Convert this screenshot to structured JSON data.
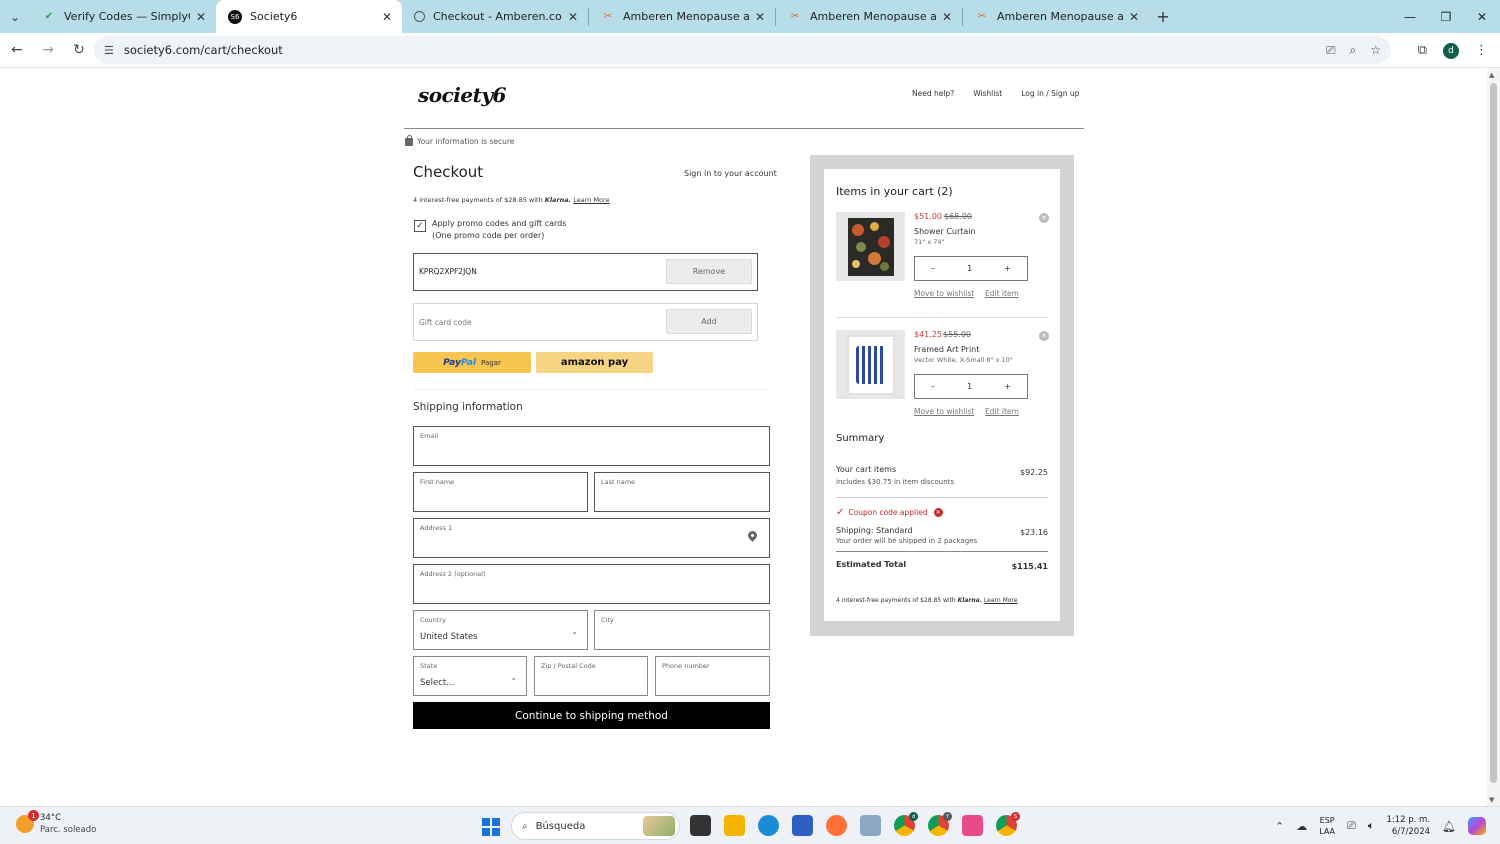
{
  "browser": {
    "tabs": [
      {
        "title": "Verify Codes — SimplyCodes",
        "active": false
      },
      {
        "title": "Society6",
        "active": true
      },
      {
        "title": "Checkout - Amberen.com",
        "active": false
      },
      {
        "title": "Amberen Menopause and Perin",
        "active": false
      },
      {
        "title": "Amberen Menopause and Perin",
        "active": false
      },
      {
        "title": "Amberen Menopause and Perin",
        "active": false
      }
    ],
    "url": "society6.com/cart/checkout",
    "profile_initial": "d"
  },
  "header": {
    "logo": "society6",
    "links": [
      "Need help?",
      "Wishlist",
      "Log in / Sign up"
    ],
    "secure_note": "Your information is secure"
  },
  "checkout": {
    "title": "Checkout",
    "sign_in": "Sign in to your account",
    "klarna": {
      "prefix": "4 interest-free payments of $28.85 with",
      "brand": "Klarna.",
      "link": "Learn More"
    },
    "promo_toggle": {
      "line1": "Apply promo codes and gift cards",
      "line2": "(One promo code per order)",
      "checked": true
    },
    "promo_code": {
      "value": "KPRQ2XPF2JQN",
      "button": "Remove"
    },
    "gift_card": {
      "placeholder": "Gift card code",
      "button": "Add"
    },
    "paypal": {
      "brand1": "Pay",
      "brand2": "Pal",
      "label": "Pagar"
    },
    "amazon_pay": "amazon pay",
    "shipping": {
      "title": "Shipping information",
      "email_label": "Email",
      "first_name_label": "First name",
      "last_name_label": "Last name",
      "address1_label": "Address 1",
      "address2_label": "Address 2 (optional)",
      "country_label": "Country",
      "country_value": "United States",
      "city_label": "City",
      "state_label": "State",
      "state_value": "Select...",
      "zip_label": "Zip / Postal Code",
      "phone_label": "Phone number"
    },
    "continue_button": "Continue to shipping method"
  },
  "cart": {
    "title": "Items in your cart (2)",
    "items": [
      {
        "sale_price": "$51.00",
        "orig_price": "$68.00",
        "name": "Shower Curtain",
        "variant": "71\" x 74\"",
        "qty": "1",
        "minus": "–",
        "plus": "+",
        "move": "Move to wishlist",
        "edit": "Edit item"
      },
      {
        "sale_price": "$41.25",
        "orig_price": "$55.00",
        "name": "Framed Art Print",
        "variant": "Vector White, X-Small 8\" x 10\"",
        "qty": "1",
        "minus": "–",
        "plus": "+",
        "move": "Move to wishlist",
        "edit": "Edit item"
      }
    ],
    "summary": {
      "title": "Summary",
      "cart_items_label": "Your cart items",
      "cart_items_sub": "includes $30.75 in item discounts",
      "cart_items_value": "$92.25",
      "coupon": "Coupon code applied",
      "shipping_label": "Shipping: Standard",
      "shipping_sub": "Your order will be shipped in 2 packages",
      "shipping_value": "$23.16",
      "total_label": "Estimated Total",
      "total_value": "$115.41"
    },
    "klarna": {
      "prefix": "4 interest-free payments of $28.85 with",
      "brand": "Klarna.",
      "link": "Learn More"
    }
  },
  "taskbar": {
    "weather_temp": "34°C",
    "weather_desc": "Parc. soleado",
    "weather_badge": "1",
    "search_placeholder": "Búsqueda",
    "lang_top": "ESP",
    "lang_bottom": "LAA",
    "time": "1:12 p. m.",
    "date": "6/7/2024"
  },
  "colors": {
    "tabbar": "#b7dde9",
    "sale_red": "#d03b3b",
    "paypal_yellow": "#f7c450",
    "amazon_yellow": "#f5d483",
    "continue_black": "#000000"
  }
}
